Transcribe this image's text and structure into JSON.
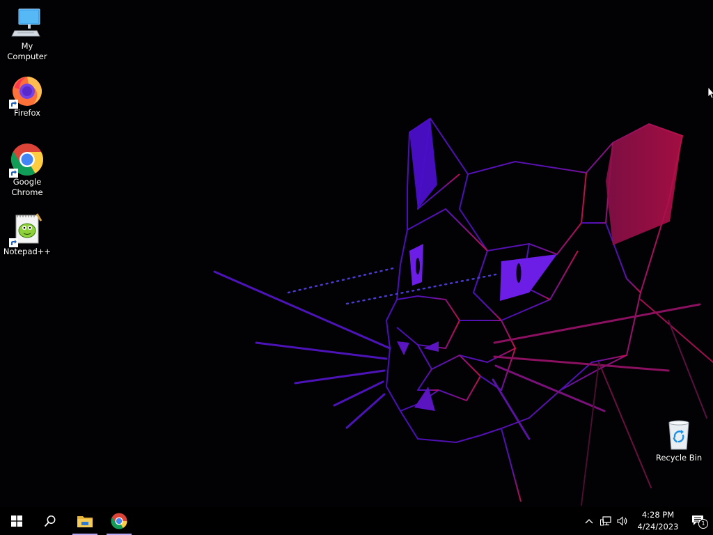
{
  "desktop_icons": {
    "my_computer": "My Computer",
    "firefox": "Firefox",
    "chrome_line1": "Google",
    "chrome_line2": "Chrome",
    "notepadpp": "Notepad++",
    "recycle_bin": "Recycle Bin"
  },
  "taskbar": {
    "clock_time": "4:28 PM",
    "clock_date": "4/24/2023",
    "notification_count": "1",
    "pinned": [
      "start-icon",
      "search-icon",
      "file-explorer-icon",
      "chrome-icon"
    ]
  },
  "colors": {
    "wallpaper_purple": "#6a1de0",
    "wallpaper_magenta": "#b0124f",
    "taskbar_running_indicator": "#b7a7f2"
  }
}
